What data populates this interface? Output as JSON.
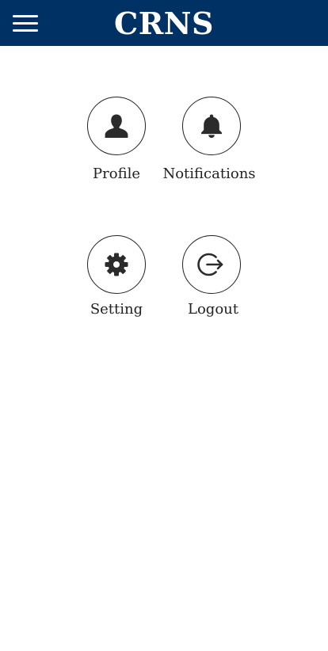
{
  "header": {
    "title": "CRNS",
    "menu_icon": "hamburger-menu-icon",
    "background": "#003164"
  },
  "tiles": [
    {
      "label": "Profile",
      "icon": "person-icon"
    },
    {
      "label": "Notifications",
      "icon": "bell-icon"
    },
    {
      "label": "Setting",
      "icon": "gear-icon"
    },
    {
      "label": "Logout",
      "icon": "logout-icon"
    }
  ]
}
